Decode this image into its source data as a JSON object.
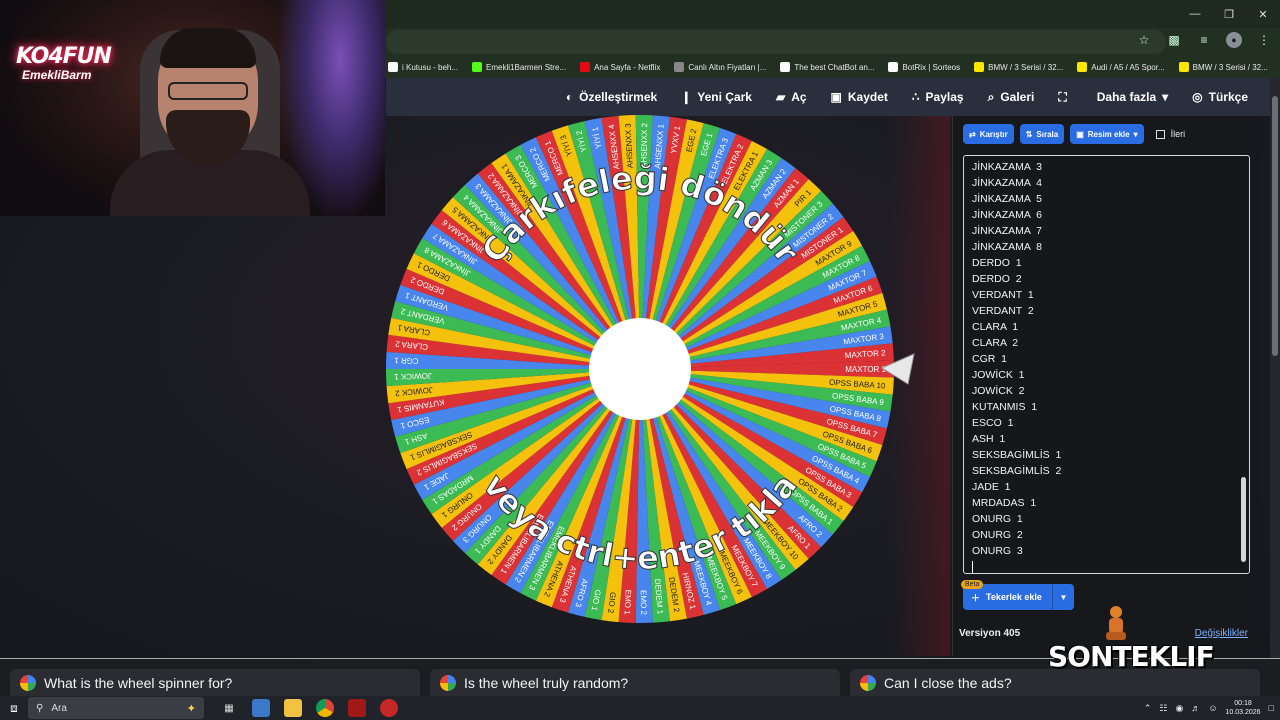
{
  "browser": {
    "bookmarks": [
      {
        "label": "i Kutusu - beh...",
        "icon": "mail-icon",
        "color": "#ffffff"
      },
      {
        "label": "Emekli1Barmen Stre...",
        "icon": "kick-icon",
        "color": "#53fc18"
      },
      {
        "label": "Ana Sayfa - Netflix",
        "icon": "netflix-icon",
        "color": "#e50914"
      },
      {
        "label": "Canlı Altın Fiyatları |...",
        "icon": "gold-icon",
        "color": "#888888"
      },
      {
        "label": "The best ChatBot an...",
        "icon": "chatbot-icon",
        "color": "#ffffff"
      },
      {
        "label": "BotRix | Sorteos",
        "icon": "botrix-icon",
        "color": "#ffffff"
      },
      {
        "label": "BMW / 3 Serisi / 32...",
        "icon": "sahibinden-icon",
        "color": "#ffe800"
      },
      {
        "label": "Audi / A5 / A5 Spor...",
        "icon": "sahibinden-icon",
        "color": "#ffe800"
      },
      {
        "label": "BMW / 3 Serisi / 32...",
        "icon": "sahibinden-icon",
        "color": "#ffe800"
      }
    ]
  },
  "nav": {
    "items": [
      {
        "label": "Özelleştirmek",
        "icon": "palette-icon"
      },
      {
        "label": "Yeni Çark",
        "icon": "new-file-icon"
      },
      {
        "label": "Aç",
        "icon": "folder-icon"
      },
      {
        "label": "Kaydet",
        "icon": "save-icon"
      },
      {
        "label": "Paylaş",
        "icon": "share-icon"
      },
      {
        "label": "Galeri",
        "icon": "search-icon"
      },
      {
        "label": "",
        "icon": "fullscreen-icon"
      },
      {
        "label": "Daha fazla",
        "icon": "caret-down-icon"
      },
      {
        "label": "Türkçe",
        "icon": "globe-icon"
      }
    ]
  },
  "wheel": {
    "top_text": "Çarkıfeleği döndür",
    "bottom_text": "veya ctrl+enter tıkla",
    "colors": [
      "#db3236",
      "#f4c20d",
      "#3cba54",
      "#4885ed"
    ],
    "segments": [
      "MAXTOR 1",
      "OPSS BABA 10",
      "OPSS BABA 9",
      "OPSS BABA 8",
      "OPSS BABA 7",
      "OPSS BABA 6",
      "OPSS BABA 5",
      "OPSS BABA 4",
      "OPSS BABA 3",
      "OPSS BABA 2",
      "OPSS BABA 1",
      "AFRO 2",
      "AFRO 1",
      "MEEKBOY 10",
      "MEEKBOY 9",
      "MEEKBOY 8",
      "MEEKBOY 7",
      "MEEKBOY 6",
      "MEEKBOY 5",
      "MEEKBOY 4",
      "HIRNOZ 1",
      "DEDEM 2",
      "DEDEM 1",
      "EMO 2",
      "EMO 1",
      "GIO 2",
      "GIO 1",
      "AFRO 3",
      "ATHENA 3",
      "ATHENA 2",
      "EMEKLIBARMEN 3",
      "EMEKLIBARMEN 2",
      "EMEKLIBARMEN 1",
      "DANDY 2",
      "DANDY 1",
      "ONURG 3",
      "ONURG 2",
      "ONURG 1",
      "MRDADAS 1",
      "JADE 1",
      "SEKSBAGIMLIS 2",
      "SEKSBAGIMLIS 1",
      "ASH 1",
      "ESCO 1",
      "KUTANMIS 1",
      "JOWICK 2",
      "JOWICK 1",
      "CGR 1",
      "CLARA 2",
      "CLARA 1",
      "VERDANT 2",
      "VERDANT 1",
      "DERDO 2",
      "DERDO 1",
      "JİNKAZAMA 8",
      "JİNKAZAMA 7",
      "JİNKAZAMA 6",
      "JİNKAZAMA 5",
      "JİNKAZAMA 4",
      "JİNKAZAMA 3",
      "JİNKAZAMA 2",
      "JİNKAZAMA 1",
      "MERCO 3",
      "MERCO 2",
      "MERCO 1",
      "YİYİ 3",
      "YİYİ 2",
      "YİYİ 1",
      "AHSENXX 4",
      "AHSENXX 3",
      "AHSENXX 2",
      "AHSENXX 1",
      "YVXV 1",
      "EGE 2",
      "EGE 1",
      "ELEKTRA 3",
      "ELEKTRA 2",
      "ELEKTRA 1",
      "AZMAN 3",
      "AZMAN 2",
      "AZMAN 1",
      "PIR 1",
      "MISTONER 3",
      "MISTONER 2",
      "MISTONER 1",
      "MAXTOR 9",
      "MAXTOR 8",
      "MAXTOR 7",
      "MAXTOR 6",
      "MAXTOR 5",
      "MAXTOR 4",
      "MAXTOR 3",
      "MAXTOR 2"
    ]
  },
  "panel": {
    "toolbar": {
      "shuffle": "Karıştır",
      "sort": "Sırala",
      "add_image": "Resim ekle",
      "advanced": "İleri"
    },
    "entries": [
      "JİNKAZAMA  3",
      "JİNKAZAMA  4",
      "JİNKAZAMA  5",
      "JİNKAZAMA  6",
      "JİNKAZAMA  7",
      "JİNKAZAMA  8",
      "DERDO  1",
      "DERDO  2",
      "VERDANT  1",
      "VERDANT  2",
      "CLARA  1",
      "CLARA  2",
      "CGR  1",
      "JOWİCK  1",
      "JOWİCK  2",
      "KUTANMIS  1",
      "ESCO  1",
      "ASH  1",
      "SEKSBAGİMLİS  1",
      "SEKSBAGİMLİS  2",
      "JADE  1",
      "MRDADAS  1",
      "ONURG  1",
      "ONURG  2",
      "ONURG  3"
    ],
    "beta": "Beta",
    "add_wheel": "Tekerlek ekle",
    "version": "Versiyon 405",
    "changes": "Değişiklikler"
  },
  "faq": [
    "What is the wheel spinner for?",
    "Is the wheel truly random?",
    "Can I close the ads?"
  ],
  "taskbar": {
    "search_placeholder": "Ara",
    "time": "00:18",
    "date": "10.03.2026"
  },
  "overlay": {
    "streamer_logo": "KO4FUN",
    "streamer_sub": "EmekliBarm",
    "brand": "SONTEKLIF"
  }
}
